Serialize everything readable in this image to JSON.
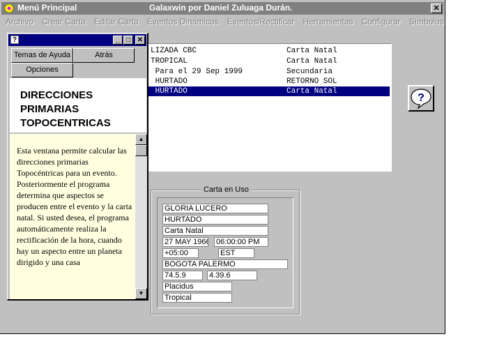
{
  "app": {
    "title": "Menú Principal",
    "subtitle": "Galaxwin  por Daniel Zuluaga Durán.",
    "close_glyph": "✕"
  },
  "menu": [
    "Archivo",
    "Crear Carta",
    "Editar Carta",
    "Eventos Dinámicos",
    "Eventos/Rectificar",
    "Herramientas",
    "Configurar",
    "Símbolos"
  ],
  "chart_list": [
    {
      "name": "LIZADA CBC",
      "type": "Carta Natal"
    },
    {
      "name": "TROPICAL",
      "type": "Carta Natal"
    },
    {
      "name": " Para el 29 Sep 1999",
      "type": "Secundaria"
    },
    {
      "name": " HURTADO",
      "type": "RETORNO SOL"
    },
    {
      "name": " HURTADO",
      "type": "Carta Natal",
      "selected": true
    }
  ],
  "help_button": {
    "glyph": "?"
  },
  "carta_en_uso": {
    "title": "Carta en Uso",
    "nombre": "GLORIA LUCERO",
    "apellido": "HURTADO",
    "tipo": "Carta Natal",
    "fecha": "27 MAY 1966",
    "hora": "06:00:00 PM",
    "zona": "+05:00",
    "zona_nombre": "EST",
    "lugar": "BOGOTA PALERMO",
    "longitud": "74.5.9",
    "latitud": "4.39.6",
    "casas": "Placidus",
    "zodiaco": "Tropical"
  },
  "help_window": {
    "sys_glyph": "?",
    "min_glyph": "_",
    "max_glyph": "□",
    "close_glyph": "✕",
    "btn_topics": "Temas de Ayuda",
    "btn_back": "Atrás",
    "btn_options": "Opciones",
    "heading": "DIRECCIONES PRIMARIAS TOPOCENTRICAS",
    "body": "Esta ventana permite calcular las direcciones primarias Topocéntricas para un evento. Posteriormente el programa determina que aspectos se producen entre el evento y la carta natal. Si usted desea, el programa automáticamente realiza la rectificación de la hora, cuando hay un aspecto entre un planeta dirigido y una casa",
    "scroll_up": "▲",
    "scroll_down": "▼"
  },
  "colors": {
    "face": "#c0c0c0",
    "selection": "#000080",
    "help_bg": "#ffffe0",
    "inactive_title": "#808080"
  }
}
